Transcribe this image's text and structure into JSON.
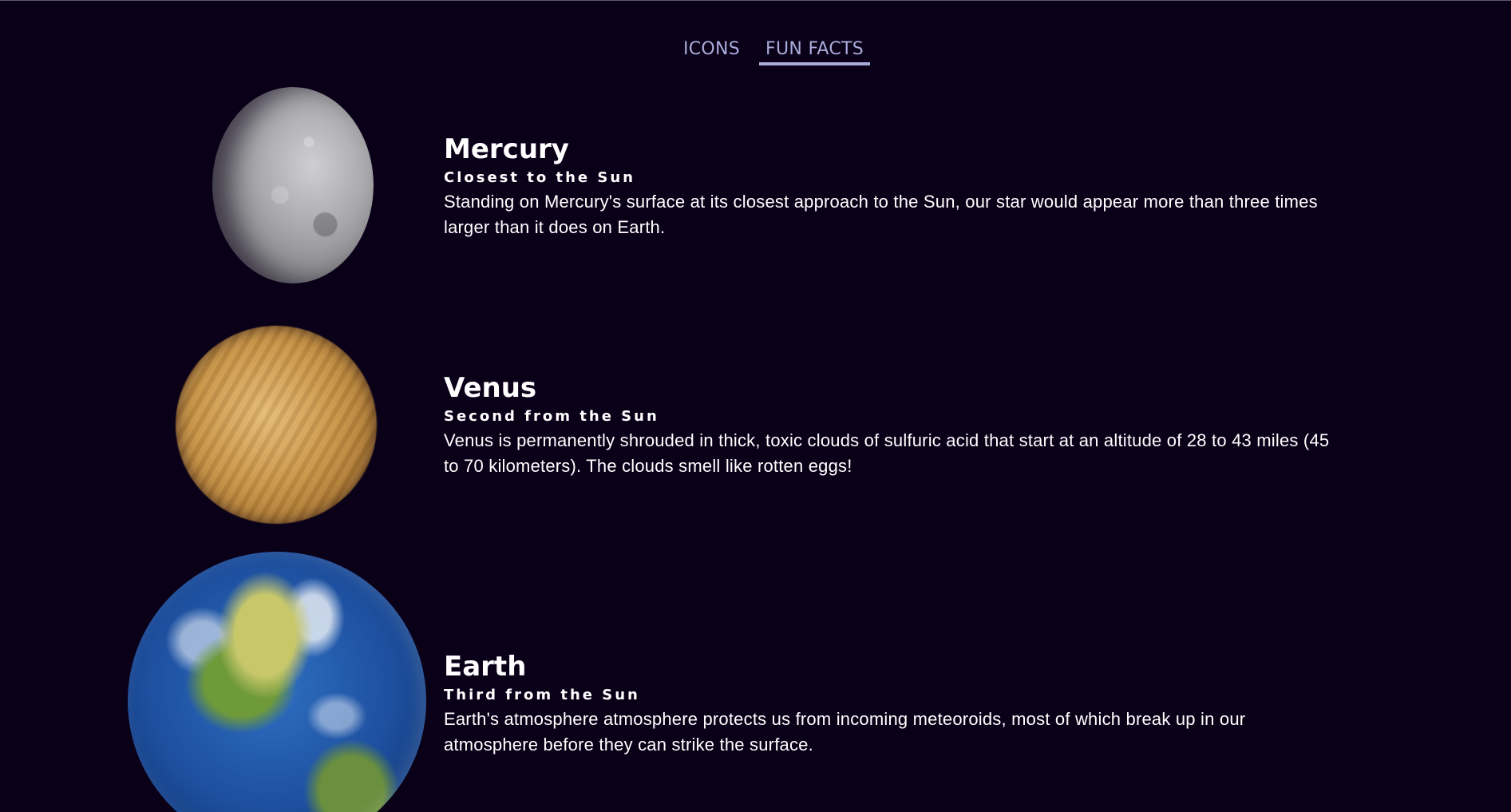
{
  "nav": {
    "tabs": [
      {
        "label": "ICONS",
        "active": false
      },
      {
        "label": "FUN FACTS",
        "active": true
      }
    ]
  },
  "planets": [
    {
      "name": "Mercury",
      "subtitle": "Closest to the Sun",
      "fact": "Standing on Mercury's surface at its closest approach to the Sun, our star would appear more than three times larger than it does on Earth.",
      "image_icon": "mercury-planet-image"
    },
    {
      "name": "Venus",
      "subtitle": "Second from the Sun",
      "fact": "Venus is permanently shrouded in thick, toxic clouds of sulfuric acid that start at an altitude of 28 to 43 miles (45 to 70 kilometers). The clouds smell like rotten eggs!",
      "image_icon": "venus-planet-image"
    },
    {
      "name": "Earth",
      "subtitle": "Third from the Sun",
      "fact": "Earth's atmosphere atmosphere protects us from incoming meteoroids, most of which break up in our atmosphere before they can strike the surface.",
      "image_icon": "earth-planet-image"
    }
  ],
  "colors": {
    "background": "#0a0018",
    "tab_text": "#a9acda",
    "text": "#ffffff"
  }
}
